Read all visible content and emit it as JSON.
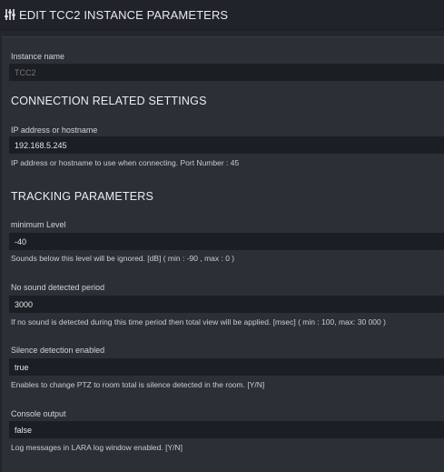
{
  "header": {
    "title": "EDIT TCC2 INSTANCE PARAMETERS",
    "icon": "sliders-icon"
  },
  "instance": {
    "label": "Instance name",
    "placeholder": "TCC2",
    "value": ""
  },
  "connection": {
    "heading": "CONNECTION RELATED SETTINGS",
    "ip": {
      "label": "IP address or hostname",
      "value": "192.168.5.245",
      "help": "IP address or hostname to use when connecting. Port Number : 45"
    }
  },
  "tracking": {
    "heading": "TRACKING PARAMETERS",
    "min_level": {
      "label": "minimum Level",
      "value": "-40",
      "help": "Sounds below this level will be ignored. [dB] ( min : -90 , max : 0 )"
    },
    "no_sound": {
      "label": "No sound detected period",
      "value": "3000",
      "help": "If no sound is detected during this time period then total view will be applied. [msec] ( min : 100, max: 30 000 )"
    },
    "silence": {
      "label": "Silence detection enabled",
      "value": "true",
      "help": "Enables to change PTZ to room total is silence detected in the room. [Y/N]"
    },
    "console": {
      "label": "Console output",
      "value": "false",
      "help": "Log messages in LARA log window enabled. [Y/N]"
    }
  },
  "colors": {
    "background": "#23262b",
    "panel": "#2c3036",
    "input": "#1b1e22",
    "text": "#d6d8db"
  }
}
